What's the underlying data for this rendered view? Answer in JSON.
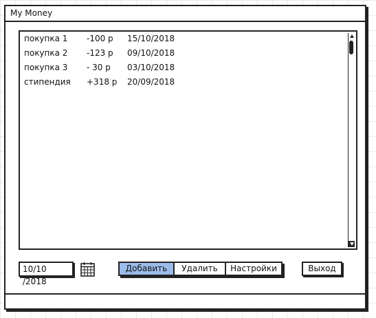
{
  "window": {
    "title": "My Money"
  },
  "transactions": [
    {
      "name": "покупка 1",
      "amount": "-100 р",
      "date": "15/10/2018"
    },
    {
      "name": "покупка 2",
      "amount": "-123 р",
      "date": "09/10/2018"
    },
    {
      "name": "покупка 3",
      "amount": "- 30 р",
      "date": "03/10/2018"
    },
    {
      "name": "стипендия",
      "amount": "+318 р",
      "date": "20/09/2018"
    }
  ],
  "date_input": {
    "value": "10/10 /2018"
  },
  "buttons": {
    "add": "Добавить",
    "delete": "Удалить",
    "settings": "Настройки",
    "exit": "Выход"
  },
  "colors": {
    "primary_button": "#9bbce9"
  },
  "icons": {
    "calendar": "calendar-icon"
  }
}
